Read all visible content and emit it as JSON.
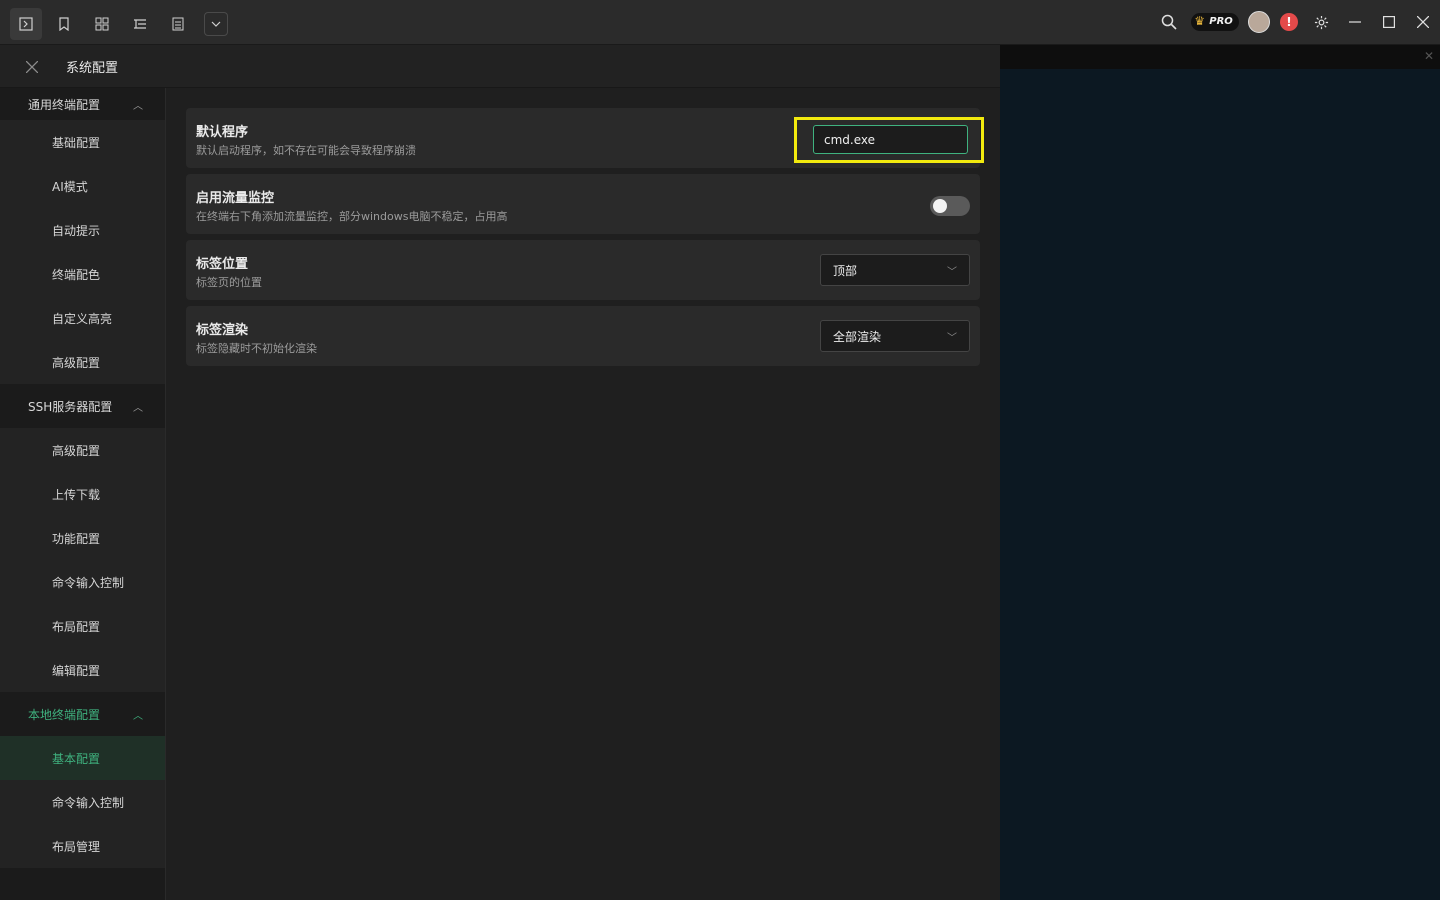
{
  "toolbar": {
    "left_icons": [
      "terminal-icon",
      "bookmark-icon",
      "layout-icon",
      "tree-icon",
      "list-icon",
      "chevron-down-icon"
    ],
    "right_icons": [
      "search-icon",
      "crown-icon",
      "avatar",
      "alert-icon",
      "gear-icon",
      "minimize-icon",
      "maximize-icon",
      "close-icon"
    ],
    "pro_label": "PRO",
    "alert_symbol": "!"
  },
  "panel": {
    "title": "系统配置"
  },
  "sidebar": {
    "groups": [
      {
        "label": "通用终端配置",
        "items": [
          "基础配置",
          "AI模式",
          "自动提示",
          "终端配色",
          "自定义高亮",
          "高级配置"
        ]
      },
      {
        "label": "SSH服务器配置",
        "items": [
          "高级配置",
          "上传下载",
          "功能配置",
          "命令输入控制",
          "布局配置",
          "编辑配置"
        ]
      },
      {
        "label": "本地终端配置",
        "items": [
          "基本配置",
          "命令输入控制",
          "布局管理"
        ],
        "selected_item": "基本配置"
      }
    ]
  },
  "settings": {
    "default_program": {
      "label": "默认程序",
      "desc": "默认启动程序，如不存在可能会导致程序崩溃",
      "value": "cmd.exe"
    },
    "traffic_monitor": {
      "label": "启用流量监控",
      "desc": "在终端右下角添加流量监控，部分windows电脑不稳定，占用高",
      "enabled": false
    },
    "tab_position": {
      "label": "标签位置",
      "desc": "标签页的位置",
      "value": "顶部"
    },
    "tab_render": {
      "label": "标签渲染",
      "desc": "标签隐藏时不初始化渲染",
      "value": "全部渲染"
    }
  },
  "colors": {
    "accent": "#3fb27f",
    "highlight": "#f2ea0e",
    "alert": "#e44a4a"
  }
}
